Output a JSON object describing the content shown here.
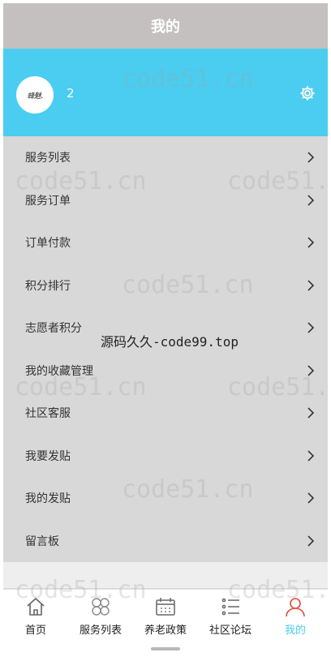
{
  "header": {
    "title": "我的"
  },
  "profile": {
    "avatar_text": "蜂魅.",
    "username": "2",
    "settings_icon": "gear-icon"
  },
  "menu": {
    "items": [
      {
        "label": "服务列表"
      },
      {
        "label": "服务订单"
      },
      {
        "label": "订单付款"
      },
      {
        "label": "积分排行"
      },
      {
        "label": "志愿者积分"
      },
      {
        "label": "我的收藏管理"
      },
      {
        "label": "社区客服"
      },
      {
        "label": "我要发贴"
      },
      {
        "label": "我的发贴"
      },
      {
        "label": "留言板"
      }
    ]
  },
  "tabbar": {
    "tabs": [
      {
        "label": "首页",
        "icon": "home-icon"
      },
      {
        "label": "服务列表",
        "icon": "grid-icon"
      },
      {
        "label": "养老政策",
        "icon": "calendar-icon"
      },
      {
        "label": "社区论坛",
        "icon": "list-icon"
      },
      {
        "label": "我的",
        "icon": "user-icon"
      }
    ],
    "active_color": "#4acdf0"
  },
  "watermark": {
    "text": "code51.cn",
    "banner": "源码久久-code99.top"
  },
  "colors": {
    "header_bg": "#c4c0bf",
    "profile_bg": "#4acdf0",
    "list_bg": "#d8d8d8"
  }
}
